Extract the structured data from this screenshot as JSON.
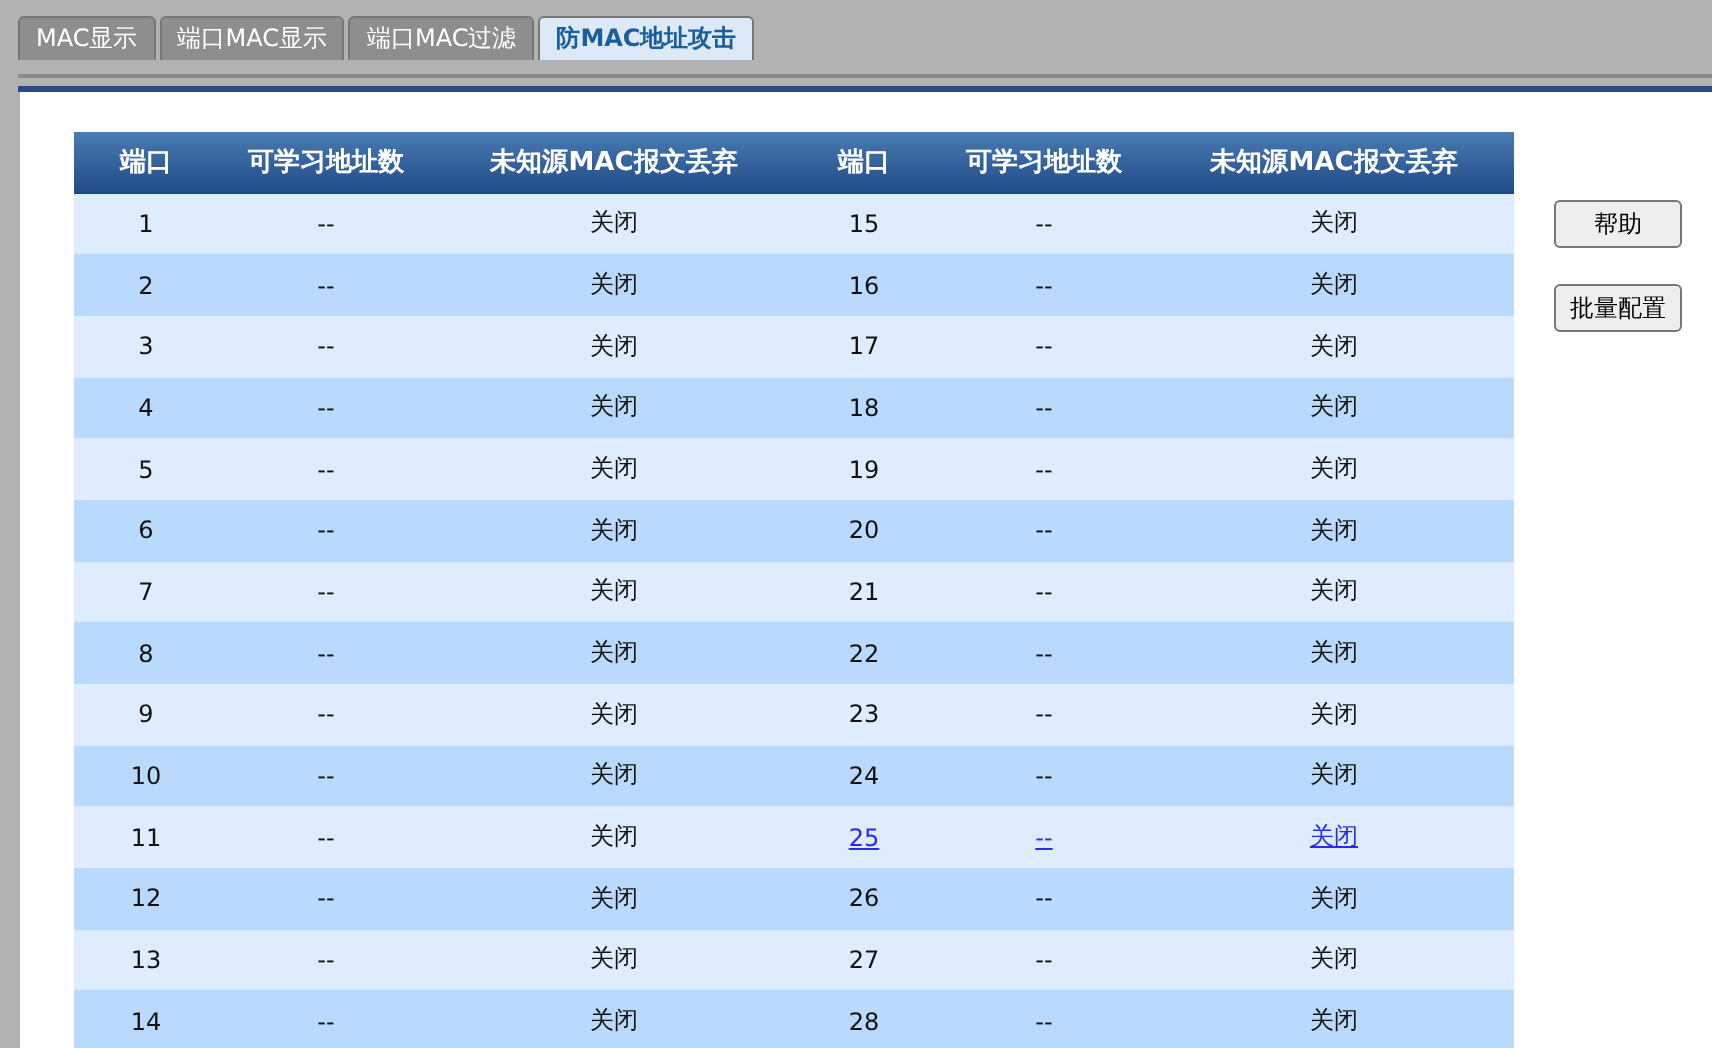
{
  "tabs": [
    {
      "label": "MAC显示",
      "selected": false
    },
    {
      "label": "端口MAC显示",
      "selected": false
    },
    {
      "label": "端口MAC过滤",
      "selected": false
    },
    {
      "label": "防MAC地址攻击",
      "selected": true
    }
  ],
  "table": {
    "columns": [
      "端口",
      "可学习地址数",
      "未知源MAC报文丢弃",
      "端口",
      "可学习地址数",
      "未知源MAC报文丢弃"
    ],
    "rows": [
      {
        "left": {
          "port": "1",
          "learn_count": "--",
          "unknown_drop": "关闭",
          "hovered": false
        },
        "right": {
          "port": "15",
          "learn_count": "--",
          "unknown_drop": "关闭",
          "hovered": false
        }
      },
      {
        "left": {
          "port": "2",
          "learn_count": "--",
          "unknown_drop": "关闭",
          "hovered": false
        },
        "right": {
          "port": "16",
          "learn_count": "--",
          "unknown_drop": "关闭",
          "hovered": false
        }
      },
      {
        "left": {
          "port": "3",
          "learn_count": "--",
          "unknown_drop": "关闭",
          "hovered": false
        },
        "right": {
          "port": "17",
          "learn_count": "--",
          "unknown_drop": "关闭",
          "hovered": false
        }
      },
      {
        "left": {
          "port": "4",
          "learn_count": "--",
          "unknown_drop": "关闭",
          "hovered": false
        },
        "right": {
          "port": "18",
          "learn_count": "--",
          "unknown_drop": "关闭",
          "hovered": false
        }
      },
      {
        "left": {
          "port": "5",
          "learn_count": "--",
          "unknown_drop": "关闭",
          "hovered": false
        },
        "right": {
          "port": "19",
          "learn_count": "--",
          "unknown_drop": "关闭",
          "hovered": false
        }
      },
      {
        "left": {
          "port": "6",
          "learn_count": "--",
          "unknown_drop": "关闭",
          "hovered": false
        },
        "right": {
          "port": "20",
          "learn_count": "--",
          "unknown_drop": "关闭",
          "hovered": false
        }
      },
      {
        "left": {
          "port": "7",
          "learn_count": "--",
          "unknown_drop": "关闭",
          "hovered": false
        },
        "right": {
          "port": "21",
          "learn_count": "--",
          "unknown_drop": "关闭",
          "hovered": false
        }
      },
      {
        "left": {
          "port": "8",
          "learn_count": "--",
          "unknown_drop": "关闭",
          "hovered": false
        },
        "right": {
          "port": "22",
          "learn_count": "--",
          "unknown_drop": "关闭",
          "hovered": false
        }
      },
      {
        "left": {
          "port": "9",
          "learn_count": "--",
          "unknown_drop": "关闭",
          "hovered": false
        },
        "right": {
          "port": "23",
          "learn_count": "--",
          "unknown_drop": "关闭",
          "hovered": false
        }
      },
      {
        "left": {
          "port": "10",
          "learn_count": "--",
          "unknown_drop": "关闭",
          "hovered": false
        },
        "right": {
          "port": "24",
          "learn_count": "--",
          "unknown_drop": "关闭",
          "hovered": false
        }
      },
      {
        "left": {
          "port": "11",
          "learn_count": "--",
          "unknown_drop": "关闭",
          "hovered": false
        },
        "right": {
          "port": "25",
          "learn_count": "--",
          "unknown_drop": "关闭",
          "hovered": true
        }
      },
      {
        "left": {
          "port": "12",
          "learn_count": "--",
          "unknown_drop": "关闭",
          "hovered": false
        },
        "right": {
          "port": "26",
          "learn_count": "--",
          "unknown_drop": "关闭",
          "hovered": false
        }
      },
      {
        "left": {
          "port": "13",
          "learn_count": "--",
          "unknown_drop": "关闭",
          "hovered": false
        },
        "right": {
          "port": "27",
          "learn_count": "--",
          "unknown_drop": "关闭",
          "hovered": false
        }
      },
      {
        "left": {
          "port": "14",
          "learn_count": "--",
          "unknown_drop": "关闭",
          "hovered": false
        },
        "right": {
          "port": "28",
          "learn_count": "--",
          "unknown_drop": "关闭",
          "hovered": false
        }
      }
    ]
  },
  "buttons": [
    "帮助",
    "批量配置"
  ]
}
